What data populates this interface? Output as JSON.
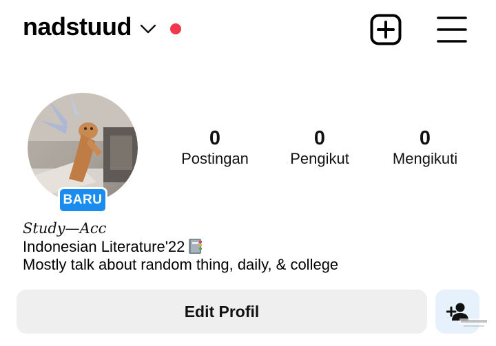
{
  "header": {
    "username": "nadstuud",
    "icons": [
      "chevron-down-icon",
      "plus-square-icon",
      "menu-icon"
    ],
    "notification_color": "#f2384b"
  },
  "profile": {
    "badge": "BARU",
    "badge_color": "#1a8cf0"
  },
  "stats": [
    {
      "value": "0",
      "label": "Postingan"
    },
    {
      "value": "0",
      "label": "Pengikut"
    },
    {
      "value": "0",
      "label": "Mengikuti"
    }
  ],
  "bio": {
    "name": "Study—Acc",
    "line1": "Indonesian Literature'22",
    "line1_icon": "notebook-emoji",
    "line2": "Mostly talk about random thing, daily, & college"
  },
  "actions": {
    "edit_label": "Edit Profil",
    "add_user_icon": "add-user-icon"
  }
}
